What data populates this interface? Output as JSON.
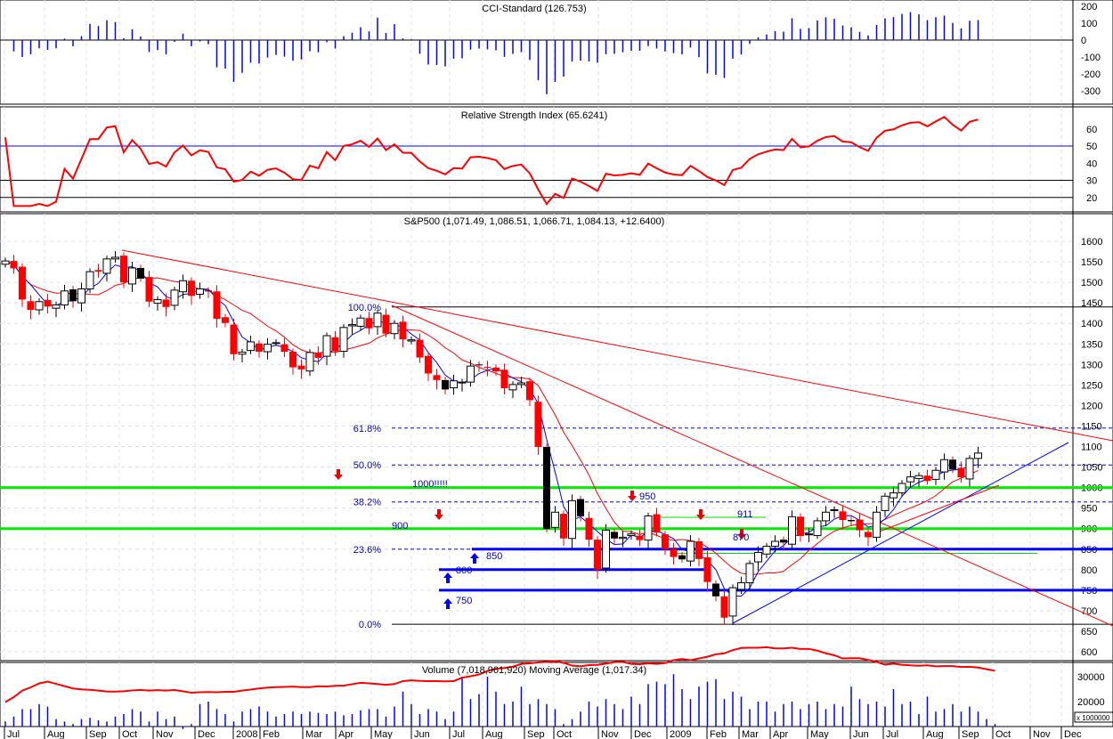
{
  "chart_data": [
    {
      "type": "bar",
      "title": "CCI-Standard (126.753)",
      "ylim": [
        -350,
        230
      ],
      "ticks": [
        200,
        100,
        0,
        -100,
        -200,
        -300
      ]
    },
    {
      "type": "line",
      "title": "Relative Strength Index (65.6241)",
      "ylim": [
        12,
        70
      ],
      "ticks": [
        60,
        50,
        40,
        30,
        20
      ],
      "ref_lines": [
        50,
        30,
        20
      ]
    },
    {
      "type": "candlestick",
      "title": "S&P500 (1,071.49, 1,086.51, 1,066.71, 1,084.13, +12.6400)",
      "ylim": [
        580,
        1620
      ],
      "ticks": [
        1600,
        1550,
        1500,
        1450,
        1400,
        1350,
        1300,
        1250,
        1200,
        1150,
        1100,
        1050,
        1000,
        950,
        900,
        850,
        800,
        750,
        700,
        650,
        600
      ],
      "weekly_close": [
        1552,
        1534,
        1458,
        1433,
        1453,
        1441,
        1445,
        1479,
        1454,
        1484,
        1526,
        1526,
        1557,
        1561,
        1500,
        1535,
        1509,
        1453,
        1458,
        1440,
        1481,
        1504,
        1467,
        1484,
        1478,
        1411,
        1401,
        1325,
        1330,
        1355,
        1331,
        1349,
        1353,
        1331,
        1293,
        1288,
        1329,
        1316,
        1370,
        1332,
        1390,
        1397,
        1413,
        1388,
        1425,
        1375,
        1400,
        1361,
        1360,
        1317,
        1278,
        1262,
        1239,
        1260,
        1257,
        1296,
        1298,
        1292,
        1283,
        1242,
        1251,
        1255,
        1213,
        1099,
        899,
        940,
        876,
        968,
        930,
        873,
        800,
        896,
        876,
        879,
        887,
        872,
        931,
        890,
        850,
        831,
        825,
        869,
        826,
        770,
        735,
        683,
        756,
        768,
        815,
        842,
        857,
        869,
        866,
        929,
        882,
        887,
        919,
        940,
        946,
        921,
        918,
        896,
        879,
        940,
        979,
        987,
        1010,
        1026,
        1029,
        1016,
        1042,
        1068,
        1044,
        1025,
        1071,
        1084
      ],
      "fib_levels": [
        {
          "label": "100.0%",
          "value": 1440
        },
        {
          "label": "61.8%",
          "value": 1145
        },
        {
          "label": "50.0%",
          "value": 1055
        },
        {
          "label": "38.2%",
          "value": 965
        },
        {
          "label": "23.6%",
          "value": 850
        },
        {
          "label": "0.0%",
          "value": 667
        }
      ],
      "support_lines": [
        {
          "label": "1000!!!!!",
          "value": 1000
        },
        {
          "label": "900",
          "value": 900
        }
      ],
      "annotations": [
        {
          "text": "950",
          "dir": "down"
        },
        {
          "text": "911",
          "dir": ""
        },
        {
          "text": "870",
          "dir": ""
        },
        {
          "text": "850",
          "dir": "up"
        },
        {
          "text": "800",
          "dir": "up"
        },
        {
          "text": "750",
          "dir": "up"
        }
      ]
    },
    {
      "type": "bar",
      "title": "Volume (7,018,961,920) Moving Average (1,017.34)",
      "ticks": [
        30000,
        20000
      ],
      "unit_label": "x 1000000",
      "values": [
        12000,
        14000,
        17000,
        17000,
        19000,
        18000,
        13000,
        12000,
        11000,
        13000,
        13500,
        12500,
        12000,
        14000,
        15000,
        17000,
        16000,
        12000,
        16000,
        13000,
        14000,
        9000,
        11000,
        19000,
        20000,
        17000,
        15000,
        12000,
        16000,
        17000,
        18000,
        16000,
        14000,
        15000,
        16000,
        15000,
        16000,
        15500,
        15000,
        16000,
        14500,
        15000,
        16500,
        17000,
        17000,
        14000,
        18000,
        24000,
        19000,
        15000,
        17000,
        16000,
        13000,
        16000,
        30000,
        21000,
        23000,
        30000,
        24000,
        19000,
        20000,
        26000,
        19000,
        21000,
        19000,
        17000,
        11000,
        13000,
        16000,
        20000,
        18000,
        21000,
        19000,
        17000,
        22000,
        19000,
        27000,
        28000,
        27000,
        31000,
        25000,
        21000,
        26000,
        28000,
        29000,
        21000,
        24000,
        22000,
        17000,
        20000,
        20000,
        16000,
        19000,
        20000,
        17000,
        19000,
        20000,
        17000,
        19000,
        18000,
        26000,
        21000,
        19000,
        20000,
        18000,
        25000,
        19000,
        20000,
        15000,
        22000,
        16000,
        17000,
        19000,
        16000,
        18000,
        16000,
        13000,
        11000
      ]
    },
    {
      "type": "axis",
      "x_tick_labels": [
        "Jul",
        "Aug",
        "Sep",
        "Oct",
        "Nov",
        "Dec",
        "2008",
        "Feb",
        "Mar",
        "Apr",
        "May",
        "Jun",
        "Jul",
        "Aug",
        "Sep",
        "Oct",
        "Nov",
        "Dec",
        "2009",
        "Feb",
        "Mar",
        "Apr",
        "May",
        "Jun",
        "Jul",
        "Aug",
        "Sep",
        "Oct",
        "Nov",
        "Dec"
      ]
    }
  ],
  "colors": {
    "up": "#ffffff",
    "down": "#ff0000",
    "ma_short": "#0000ff",
    "ma_long": "#ff0000",
    "support": "#00ee00",
    "fib": "#0000ff",
    "annotation_text": "#0000cc"
  }
}
